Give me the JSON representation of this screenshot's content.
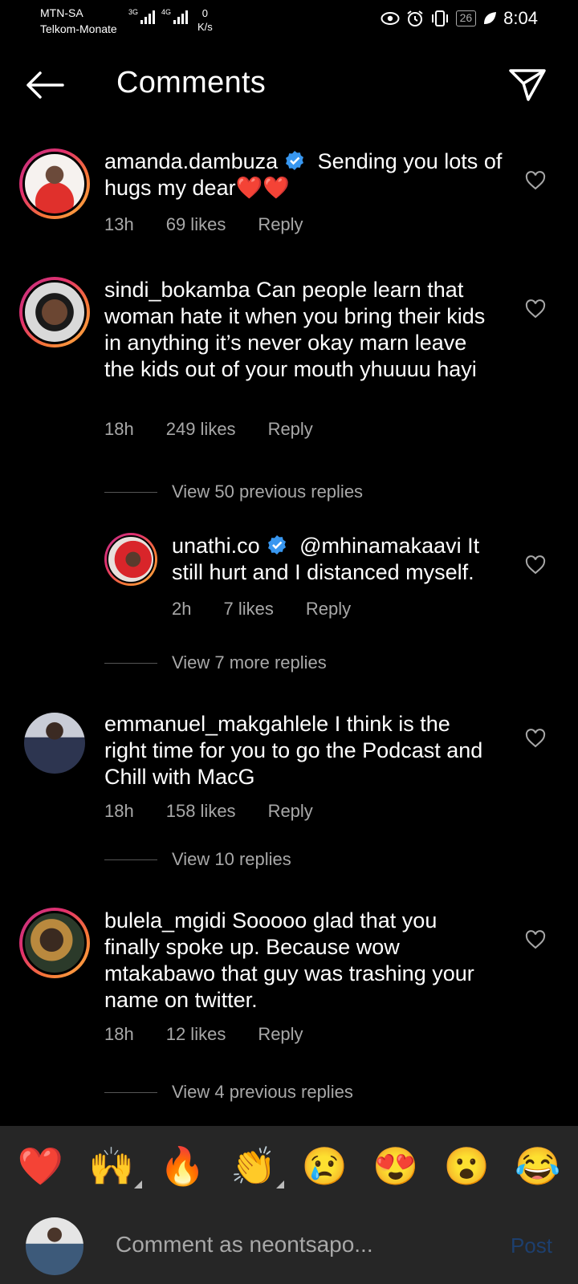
{
  "status_bar": {
    "carrier_1": "MTN-SA",
    "carrier_2": "Telkom-Monate",
    "signal_1_label": "3G",
    "signal_2_label": "4G",
    "speed_value": "0",
    "speed_unit": "K/s",
    "battery": "26",
    "time": "8:04"
  },
  "header": {
    "title": "Comments"
  },
  "comments": [
    {
      "username": "amanda.dambuza",
      "verified": true,
      "text": "Sending you lots of hugs my dear❤️❤️",
      "time": "13h",
      "likes": "69 likes",
      "reply": "Reply"
    },
    {
      "username": "sindi_bokamba",
      "verified": false,
      "text": "Can people learn that woman hate it when you bring their kids in anything it’s never okay marn leave the kids out of your mouth yhuuuu hayi",
      "time": "18h",
      "likes": "249 likes",
      "reply": "Reply",
      "view_replies": "View 50 previous replies"
    },
    {
      "username": "unathi.co",
      "verified": true,
      "text": "@mhinamakaavi It still hurt and I distanced myself.",
      "time": "2h",
      "likes": "7 likes",
      "reply": "Reply",
      "view_replies": "View 7 more replies"
    },
    {
      "username": "emmanuel_makgahlele",
      "verified": false,
      "text": "I think is the right time for you to go the Podcast and Chill with MacG",
      "time": "18h",
      "likes": "158 likes",
      "reply": "Reply",
      "view_replies": "View 10 replies"
    },
    {
      "username": "bulela_mgidi",
      "verified": false,
      "text": "Sooooo glad that you finally spoke up. Because wow mtakabawo that guy was trashing your name on twitter.",
      "time": "18h",
      "likes": "12 likes",
      "reply": "Reply",
      "view_replies": "View 4 previous replies"
    }
  ],
  "emoji_bar": [
    "❤️",
    "🙌",
    "🔥",
    "👏",
    "😢",
    "😍",
    "😮",
    "😂"
  ],
  "composer": {
    "placeholder": "Comment as neontsapo...",
    "post_label": "Post"
  },
  "colors": {
    "background": "#000000",
    "secondary_text": "#a8a8a8",
    "verified_blue": "#3897f0",
    "post_disabled": "#1d3f6e",
    "bar_background": "#262626"
  }
}
